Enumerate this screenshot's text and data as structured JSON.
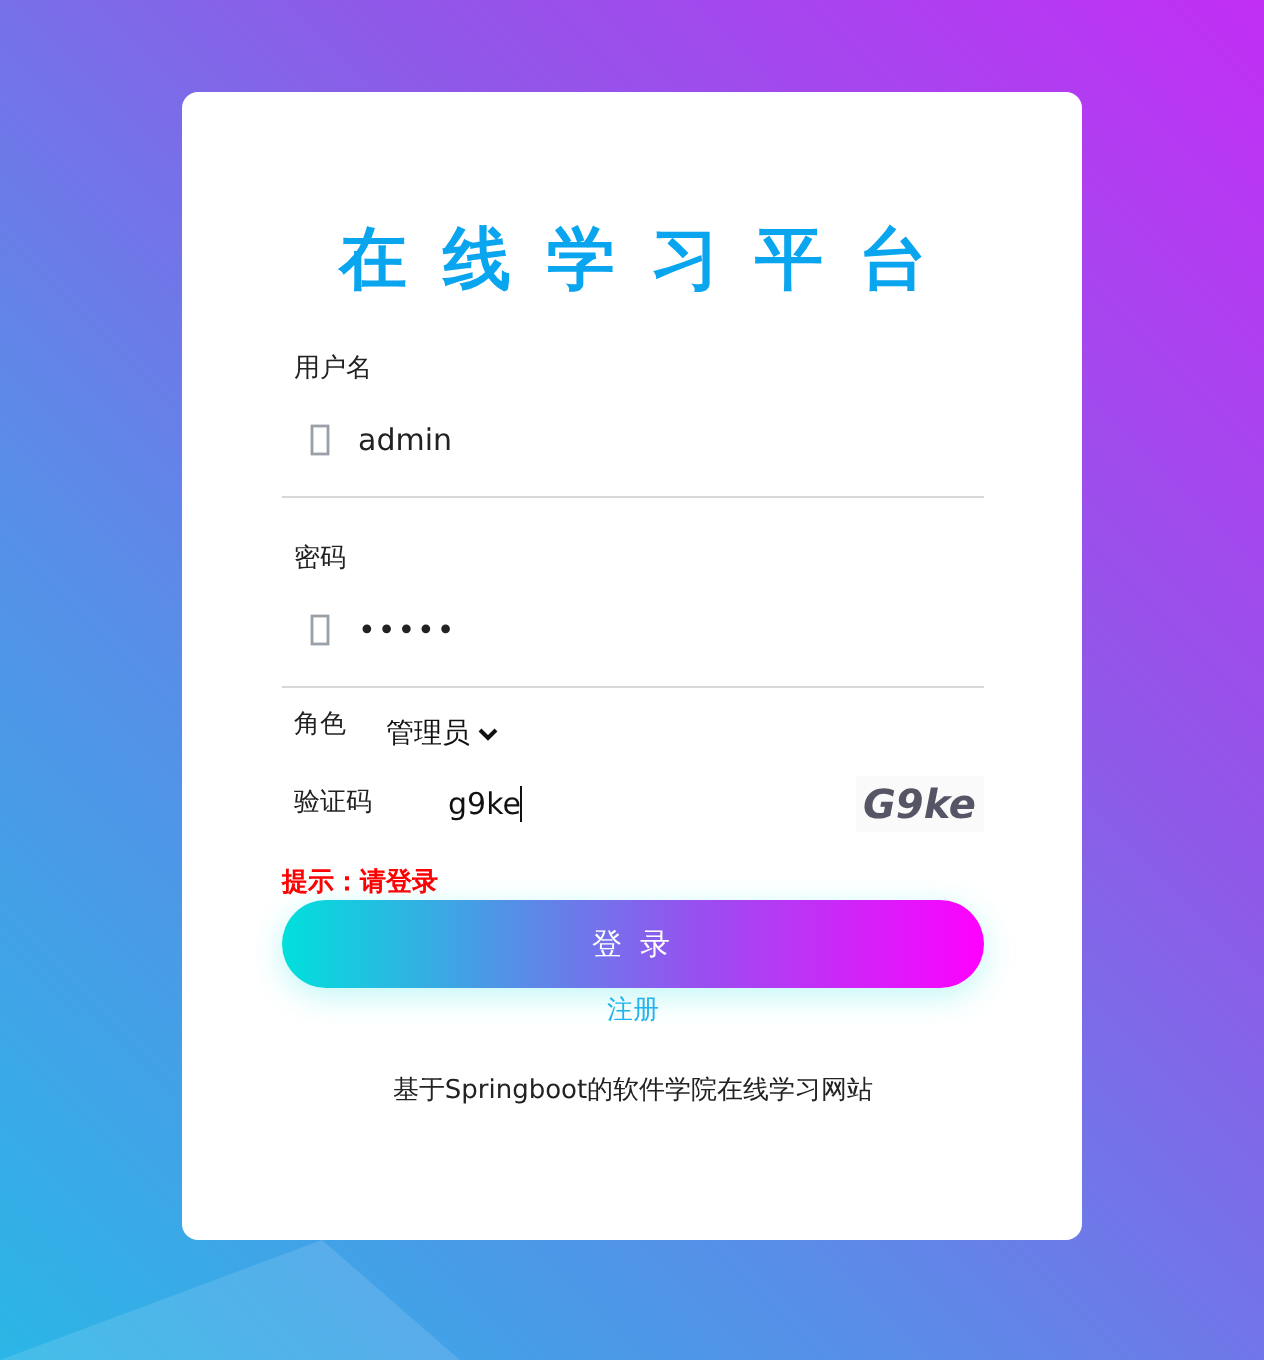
{
  "title": "在线学习平台",
  "fields": [
    {
      "label": "用户名",
      "value": "admin"
    },
    {
      "label": "密码",
      "value": "•••••"
    }
  ],
  "role": {
    "label": "角色",
    "value": "管理员"
  },
  "captcha": {
    "label": "验证码",
    "value": "g9ke",
    "image_text": "G9ke"
  },
  "hint": "提示：请登录",
  "login_button": "登 录",
  "register_link": "注册",
  "footer": "基于Springboot的软件学院在线学习网站"
}
